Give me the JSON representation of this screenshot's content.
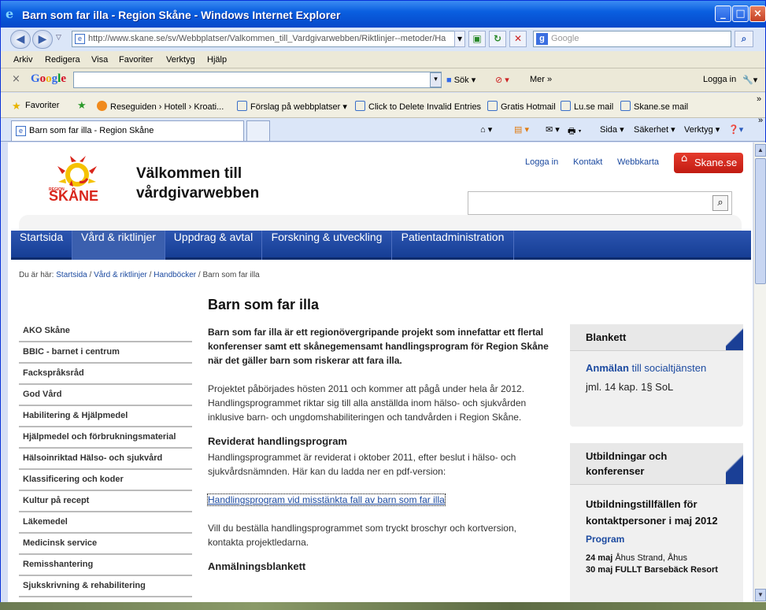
{
  "window": {
    "title": "Barn som far illa - Region Skåne - Windows Internet Explorer",
    "address": "http://www.skane.se/sv/Webbplatser/Valkommen_till_Vardgivarwebben/Riktlinjer--metoder/Ha",
    "search_placeholder": "Google"
  },
  "menu": [
    "Arkiv",
    "Redigera",
    "Visa",
    "Favoriter",
    "Verktyg",
    "Hjälp"
  ],
  "google_toolbar": {
    "logo": "Google",
    "search_label": "Sök",
    "more_label": "Mer »",
    "login_label": "Logga in"
  },
  "favorites": {
    "label": "Favoriter",
    "items": [
      "Reseguiden › Hotell › Kroati...",
      "Förslag på webbplatser",
      "Click to Delete Invalid Entries",
      "Gratis Hotmail",
      "Lu.se mail",
      "Skane.se mail"
    ]
  },
  "tab": {
    "label": "Barn som far illa - Region Skåne"
  },
  "command_bar": [
    "Sida",
    "Säkerhet",
    "Verktyg"
  ],
  "site": {
    "logo_small": "REGION",
    "logo_text": "SKÅNE",
    "title": "Välkommen till vårdgivarwebben",
    "links": [
      "Logga in",
      "Kontakt",
      "Webbkarta"
    ],
    "skane_button": "Skane.se",
    "nav": [
      "Startsida",
      "Vård & riktlinjer",
      "Uppdrag & avtal",
      "Forskning & utveckling",
      "Patientadministration"
    ],
    "breadcrumb_prefix": "Du är här:",
    "breadcrumb": [
      "Startsida",
      "Vård & riktlinjer",
      "Handböcker",
      "Barn som far illa"
    ]
  },
  "left_nav": [
    "AKO Skåne",
    "BBIC - barnet i centrum",
    "Fackspråksråd",
    "God Vård",
    "Habilitering & Hjälpmedel",
    "Hjälpmedel och förbrukningsmaterial",
    "Hälsoinriktad Hälso- och sjukvård",
    "Klassificering och koder",
    "Kultur på recept",
    "Läkemedel",
    "Medicinsk service",
    "Remisshantering",
    "Sjukskrivning & rehabilitering"
  ],
  "main": {
    "heading": "Barn som far illa",
    "lead": "Barn som far illa är ett regionövergripande projekt som innefattar ett flertal konferenser samt ett skånegemensamt handlingsprogram för Region Skåne när det gäller barn som riskerar att fara illa.",
    "p1": "Projektet påbörjades hösten 2011 och kommer att pågå under hela år 2012. Handlingsprogrammet riktar sig till alla anställda inom hälso- och sjukvården inklusive barn- och ungdomshabiliteringen och tandvården i Region Skåne.",
    "h_revised": "Reviderat handlingsprogram",
    "p2": "Handlingsprogrammet är reviderat i oktober 2011, efter beslut i hälso- och sjukvårdsnämnden. Här kan du ladda ner en pdf-version:",
    "link": "Handlingsprogram vid misstänkta fall av barn som far illa",
    "p3": "Vill du beställa handlingsprogrammet som tryckt broschyr och kortversion, kontakta projektledarna.",
    "h_form": "Anmälningsblankett"
  },
  "right": {
    "box1_title": "Blankett",
    "box1_link": "Anmälan",
    "box1_link_rest": "till socialtjänsten",
    "box1_text": "jml. 14 kap. 1§ SoL",
    "box2_title": "Utbildningar och konferenser",
    "box2_sub": "Utbildningstillfällen för kontaktpersoner i maj 2012",
    "box2_program": "Program",
    "box2_date1_day": "24 maj",
    "box2_date1_place": "Åhus Strand, Åhus",
    "box2_date2": "30 maj FULLT Barsebäck Resort"
  },
  "colors": {
    "nav_bg": "#1f4aa5",
    "brand_red": "#d9261c",
    "link": "#1c4aa0"
  }
}
